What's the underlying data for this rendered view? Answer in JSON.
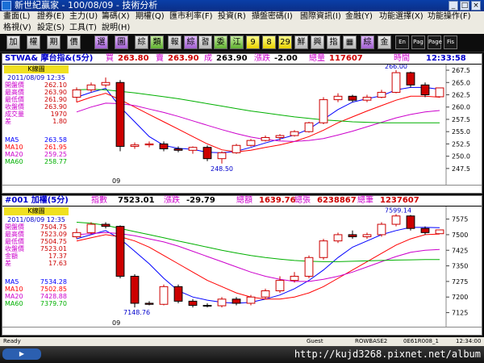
{
  "window": {
    "title": "新世紀贏家 - 100/08/09 - 技術分析"
  },
  "menu": {
    "row1": [
      "畫面(L)",
      "證券(E)",
      "主力(U)",
      "籌碼(X)",
      "期權(Q)",
      "匯市利率(F)",
      "投資(R)",
      "擷盤密碼(I)",
      "國際資訊(I)",
      "金融(Y)",
      "功能選擇(X)",
      "功能操作(F)"
    ],
    "row2": [
      "格視(V)",
      "設定(S)",
      "工具(T)",
      "說明(H)"
    ]
  },
  "toolbar": {
    "buttons": [
      "加",
      "權",
      "期",
      "價",
      "選",
      "圖",
      "綜",
      "類",
      "報",
      "綜",
      "習",
      "委",
      "江",
      "9",
      "8",
      "29",
      "鮮",
      "興",
      "指",
      "▦",
      "綜",
      "金",
      "En",
      "Pag",
      "Page",
      "Fis"
    ]
  },
  "top_panel": {
    "header": {
      "symbol": "STWA& 摩台指&(5分)",
      "buy_label": "買",
      "buy": "263.80",
      "sell_label": "賣",
      "sell": "263.90",
      "deal_label": "成",
      "deal": "263.90",
      "change_label": "漲跌",
      "change": "-2.00",
      "volume_label": "總量",
      "volume": "117607",
      "time_label": "時間",
      "time": "12:33:58"
    },
    "info": {
      "title": "K線圖",
      "date": "2011/08/09 12:35",
      "rows": [
        {
          "label": "開盤價",
          "value": "262.10"
        },
        {
          "label": "最高價",
          "value": "263.90"
        },
        {
          "label": "最低價",
          "value": "261.90"
        },
        {
          "label": "收盤價",
          "value": "263.90"
        },
        {
          "label": "成交量",
          "value": "1970"
        },
        {
          "label": "差",
          "value": "1.80"
        }
      ],
      "ma": [
        {
          "label": "MA5",
          "value": "263.58",
          "color": "#0000ff"
        },
        {
          "label": "MA10",
          "value": "261.95",
          "color": "#ff0000"
        },
        {
          "label": "MA20",
          "value": "259.25",
          "color": "#cc00cc"
        },
        {
          "label": "MA60",
          "value": "258.77",
          "color": "#00b000"
        }
      ]
    },
    "yticks": [
      "267.5",
      "265.0",
      "262.5",
      "260.0",
      "257.5",
      "255.0",
      "252.5",
      "250.0",
      "247.5"
    ],
    "high_label": "266.00",
    "low_label": "248.50",
    "xlabel": "09"
  },
  "bottom_panel": {
    "header": {
      "symbol": "#001 加權(5分)",
      "index_label": "指數",
      "index": "7523.01",
      "change_label": "漲跌",
      "change": "-29.79",
      "amount_label": "總額",
      "amount": "1639.76",
      "vol_label": "總張",
      "vol": "6238867",
      "count_label": "總筆",
      "count": "1237607"
    },
    "info": {
      "title": "K線圖",
      "date": "2011/08/09 12:35",
      "rows": [
        {
          "label": "開盤價",
          "value": "7504.75"
        },
        {
          "label": "最高價",
          "value": "7523.09"
        },
        {
          "label": "最低價",
          "value": "7504.75"
        },
        {
          "label": "收盤價",
          "value": "7523.01"
        },
        {
          "label": "金額",
          "value": "17.37"
        },
        {
          "label": "差",
          "value": "17.63"
        }
      ],
      "ma": [
        {
          "label": "MA5",
          "value": "7534.28",
          "color": "#0000ff"
        },
        {
          "label": "MA10",
          "value": "7502.85",
          "color": "#ff0000"
        },
        {
          "label": "MA20",
          "value": "7428.88",
          "color": "#cc00cc"
        },
        {
          "label": "MA60",
          "value": "7379.70",
          "color": "#00b000"
        }
      ]
    },
    "yticks": [
      "7575",
      "7500",
      "7425",
      "7350",
      "7275",
      "7200",
      "7125"
    ],
    "high_label": "7599.14",
    "low_label": "7148.76",
    "xlabel": "09"
  },
  "status": {
    "left": "Ready",
    "guest": "Guest",
    "server": "ROWBASE2",
    "code": "0E61R008_1",
    "clock": "12:34:00"
  },
  "taskbar": {
    "url": "http://kujd3268.pixnet.net/album"
  },
  "chart_data": [
    {
      "type": "candlestick",
      "title": "STWA& 摩台指&(5分)",
      "ylim": [
        246,
        268
      ],
      "candles": [
        [
          262,
          264,
          261,
          263.5
        ],
        [
          263.5,
          265,
          263,
          264.5
        ],
        [
          264.5,
          266,
          264,
          265
        ],
        [
          265,
          265.5,
          251,
          252
        ],
        [
          252,
          252.8,
          251.5,
          252.3
        ],
        [
          252.3,
          253,
          251.8,
          252.5
        ],
        [
          252.5,
          253,
          251,
          251.5
        ],
        [
          251.5,
          252,
          250.8,
          251.2
        ],
        [
          251.2,
          252,
          250.5,
          251.8
        ],
        [
          251.8,
          252.2,
          249,
          249.5
        ],
        [
          249.5,
          251,
          248.5,
          250.7
        ],
        [
          250.7,
          252.5,
          250.5,
          252.2
        ],
        [
          252.2,
          253.5,
          252,
          253.2
        ],
        [
          253.2,
          254.2,
          253,
          253.8
        ],
        [
          253.8,
          254.5,
          253.2,
          254.2
        ],
        [
          254.2,
          255.3,
          254,
          255
        ],
        [
          255,
          257,
          254.8,
          256.8
        ],
        [
          256.8,
          262,
          256.5,
          261.5
        ],
        [
          261.5,
          262.8,
          261,
          262.2
        ],
        [
          262.2,
          262.5,
          261,
          261.4
        ],
        [
          261.4,
          262.5,
          261,
          262
        ],
        [
          262,
          263.5,
          261.8,
          263
        ],
        [
          263,
          267.5,
          262.8,
          267
        ],
        [
          267,
          267.2,
          264,
          264.5
        ],
        [
          264.5,
          265,
          262,
          262.5
        ],
        [
          262.1,
          263.9,
          261.9,
          263.9
        ]
      ],
      "ma": [
        {
          "name": "MA5",
          "color": "#0000ff",
          "values": [
            262,
            263,
            263.8,
            260,
            257,
            254,
            252.2,
            251.6,
            251.4,
            250.8,
            250.7,
            251,
            251.8,
            252.7,
            253.5,
            254.3,
            255.5,
            257.5,
            259.5,
            261,
            261.7,
            262.3,
            263.5,
            264,
            264,
            263.6
          ]
        },
        {
          "name": "MA10",
          "color": "#ff0000",
          "values": [
            261,
            262,
            262.8,
            261.5,
            260,
            258.5,
            257,
            255.5,
            254,
            252.5,
            251.3,
            250.9,
            251.2,
            251.8,
            252.3,
            253,
            254,
            255.3,
            256.8,
            258,
            259.2,
            260.3,
            261.4,
            262.2,
            262.2,
            262
          ]
        },
        {
          "name": "MA20",
          "color": "#cc00cc",
          "values": [
            259,
            260,
            260.8,
            260.7,
            260.3,
            259.6,
            258.9,
            258.1,
            257.2,
            256.3,
            255.4,
            254.6,
            253.9,
            253.4,
            253.1,
            253,
            253.2,
            253.6,
            254.3,
            255.1,
            256,
            256.9,
            257.8,
            258.5,
            259,
            259.3
          ]
        },
        {
          "name": "MA60",
          "color": "#00b000",
          "values": [
            263.5,
            263.6,
            263.5,
            263.2,
            262.9,
            262.5,
            262.1,
            261.7,
            261.2,
            260.7,
            260.2,
            259.7,
            259.2,
            258.8,
            258.4,
            258,
            257.7,
            257.4,
            257.2,
            257,
            256.9,
            256.8,
            256.8,
            256.8,
            256.8,
            256.8
          ]
        }
      ]
    },
    {
      "type": "candlestick",
      "title": "#001 加權(5分)",
      "ylim": [
        7100,
        7620
      ],
      "candles": [
        [
          7490,
          7530,
          7480,
          7510
        ],
        [
          7510,
          7560,
          7500,
          7550
        ],
        [
          7550,
          7560,
          7530,
          7540
        ],
        [
          7540,
          7545,
          7290,
          7300
        ],
        [
          7300,
          7310,
          7150,
          7170
        ],
        [
          7170,
          7180,
          7160,
          7165
        ],
        [
          7165,
          7260,
          7160,
          7250
        ],
        [
          7250,
          7260,
          7170,
          7180
        ],
        [
          7180,
          7190,
          7150,
          7160
        ],
        [
          7160,
          7170,
          7150,
          7158
        ],
        [
          7158,
          7200,
          7150,
          7190
        ],
        [
          7190,
          7200,
          7160,
          7170
        ],
        [
          7170,
          7210,
          7160,
          7200
        ],
        [
          7200,
          7240,
          7190,
          7230
        ],
        [
          7230,
          7300,
          7220,
          7280
        ],
        [
          7280,
          7320,
          7270,
          7300
        ],
        [
          7300,
          7400,
          7290,
          7390
        ],
        [
          7390,
          7480,
          7380,
          7470
        ],
        [
          7470,
          7510,
          7460,
          7500
        ],
        [
          7500,
          7520,
          7480,
          7490
        ],
        [
          7490,
          7510,
          7480,
          7500
        ],
        [
          7500,
          7560,
          7490,
          7550
        ],
        [
          7550,
          7599,
          7540,
          7590
        ],
        [
          7590,
          7595,
          7520,
          7530
        ],
        [
          7530,
          7540,
          7500,
          7510
        ],
        [
          7504.75,
          7523.09,
          7504.75,
          7523.01
        ]
      ],
      "ma": [
        {
          "name": "MA5",
          "color": "#0000ff",
          "values": [
            7480,
            7500,
            7520,
            7480,
            7420,
            7360,
            7290,
            7230,
            7200,
            7185,
            7175,
            7170,
            7175,
            7190,
            7210,
            7240,
            7280,
            7330,
            7390,
            7440,
            7470,
            7500,
            7520,
            7535,
            7535,
            7534
          ]
        },
        {
          "name": "MA10",
          "color": "#ff0000",
          "values": [
            7470,
            7485,
            7500,
            7490,
            7470,
            7440,
            7400,
            7360,
            7320,
            7280,
            7250,
            7220,
            7200,
            7190,
            7190,
            7200,
            7220,
            7250,
            7290,
            7330,
            7370,
            7410,
            7450,
            7480,
            7500,
            7503
          ]
        },
        {
          "name": "MA20",
          "color": "#cc00cc",
          "values": [
            7500,
            7505,
            7510,
            7505,
            7495,
            7480,
            7465,
            7445,
            7420,
            7395,
            7370,
            7345,
            7320,
            7300,
            7285,
            7275,
            7275,
            7285,
            7300,
            7320,
            7345,
            7370,
            7395,
            7415,
            7425,
            7429
          ]
        },
        {
          "name": "MA60",
          "color": "#00b000",
          "values": [
            7560,
            7555,
            7545,
            7530,
            7515,
            7500,
            7485,
            7470,
            7455,
            7440,
            7425,
            7412,
            7400,
            7390,
            7382,
            7376,
            7372,
            7370,
            7370,
            7372,
            7374,
            7376,
            7378,
            7379,
            7380,
            7380
          ]
        }
      ]
    }
  ]
}
